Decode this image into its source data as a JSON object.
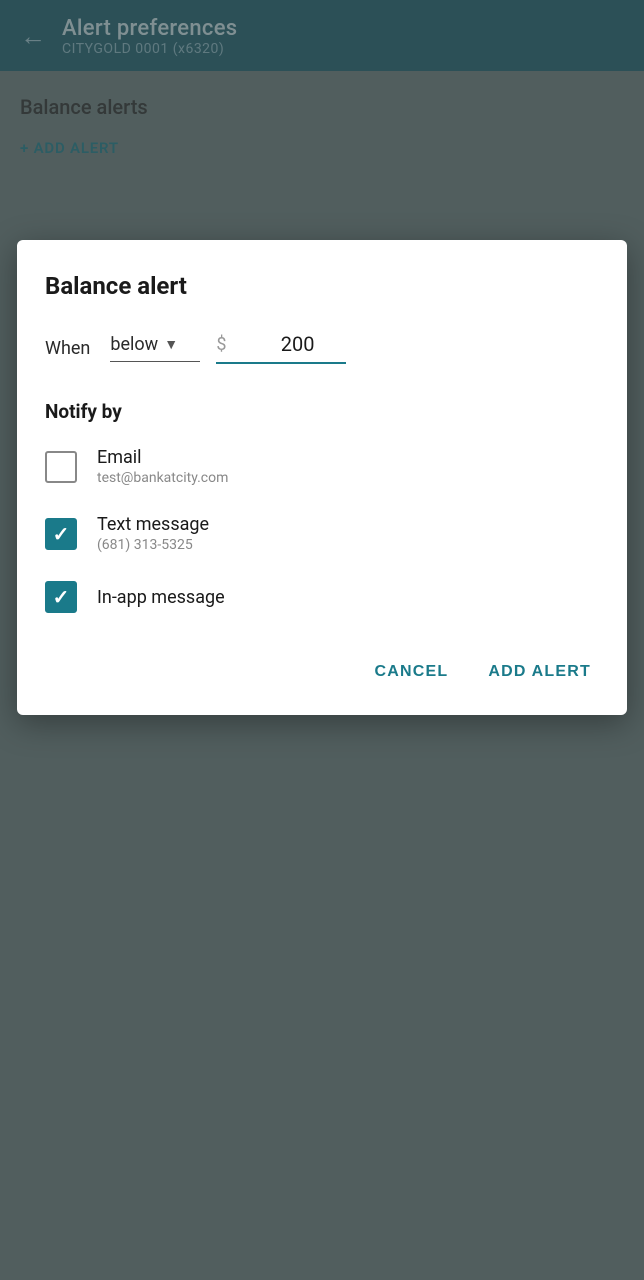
{
  "header": {
    "back_label": "←",
    "title": "Alert preferences",
    "subtitle": "CITYGOLD    0001 (x6320)"
  },
  "background": {
    "section_title": "Balance alerts",
    "add_alert_label": "+ ADD ALERT"
  },
  "dialog": {
    "title": "Balance alert",
    "when_label": "When",
    "condition_value": "below",
    "dropdown_chevron": "▼",
    "currency_symbol": "$",
    "amount_value": "200",
    "notify_by_label": "Notify by",
    "notify_options": [
      {
        "id": "email",
        "label": "Email",
        "sub_label": "test@bankatcity.com",
        "checked": false
      },
      {
        "id": "text",
        "label": "Text message",
        "sub_label": "(681) 313-5325",
        "checked": true
      },
      {
        "id": "inapp",
        "label": "In-app message",
        "sub_label": "",
        "checked": true
      }
    ],
    "cancel_label": "CANCEL",
    "add_alert_label": "ADD ALERT"
  }
}
